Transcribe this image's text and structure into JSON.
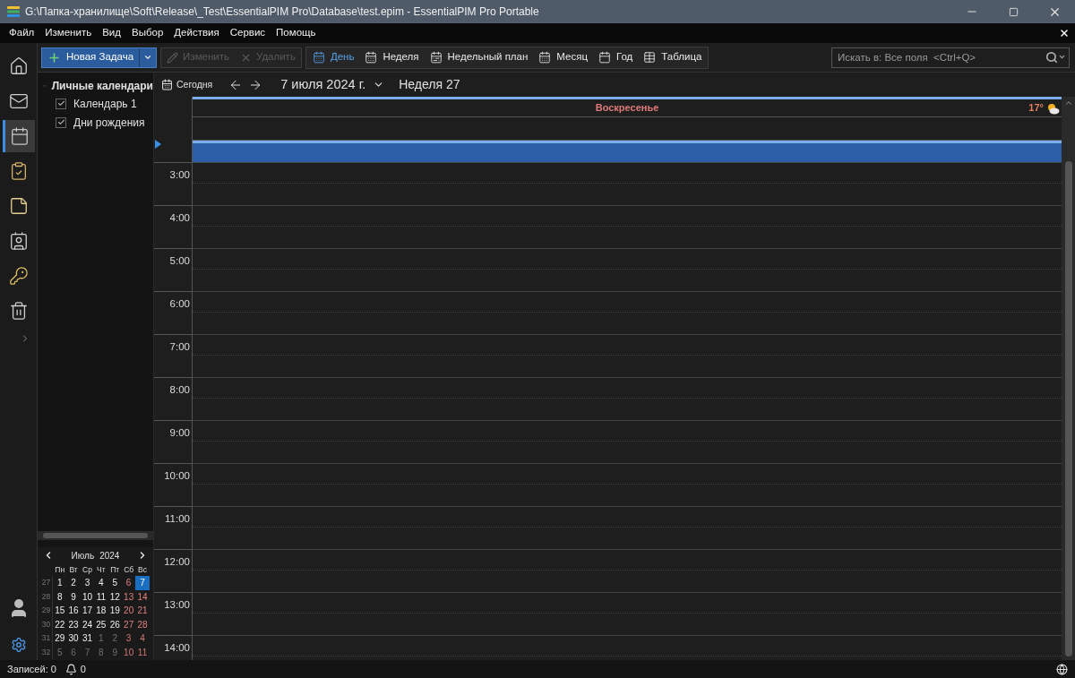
{
  "window": {
    "title": "G:\\Папка-хранилище\\Soft\\Release\\_Test\\EssentialPIM Pro\\Database\\test.epim - EssentialPIM Pro Portable"
  },
  "menu": [
    "Файл",
    "Изменить",
    "Вид",
    "Выбор",
    "Действия",
    "Сервис",
    "Помощь"
  ],
  "toolbar": {
    "new_button": "Новая Задача",
    "actions": [
      {
        "kind": "edit",
        "label": "Изменить",
        "disabled": true
      },
      {
        "kind": "delete",
        "label": "Удалить",
        "disabled": true
      }
    ],
    "views": [
      {
        "label": "День",
        "selected": true
      },
      {
        "label": "Неделя",
        "selected": false
      },
      {
        "label": "Недельный план",
        "selected": false
      },
      {
        "label": "Месяц",
        "selected": false
      },
      {
        "label": "Год",
        "selected": false
      },
      {
        "label": "Таблица",
        "selected": false
      }
    ],
    "search": {
      "placeholder": "Искать в: Все поля  <Ctrl+Q>"
    }
  },
  "nav_rail": [
    {
      "kind": "home",
      "selected": false
    },
    {
      "kind": "mail",
      "selected": false
    },
    {
      "kind": "calendar",
      "selected": true
    },
    {
      "kind": "tasks",
      "selected": false
    },
    {
      "kind": "notes",
      "selected": false
    },
    {
      "kind": "contacts",
      "selected": false
    },
    {
      "kind": "passwords",
      "selected": false
    },
    {
      "kind": "trash",
      "selected": false
    }
  ],
  "sidebar": {
    "label": "Личные календари",
    "expanded": true,
    "children": [
      {
        "label": "Календарь 1",
        "checked": true
      },
      {
        "label": "Дни рождения",
        "checked": true
      }
    ]
  },
  "mini_calendar": {
    "month": "Июль",
    "year": "2024",
    "weekdays": [
      "Пн",
      "Вт",
      "Ср",
      "Чт",
      "Пт",
      "Сб",
      "Вс"
    ],
    "weeks": [
      {
        "number": "27",
        "days": [
          {
            "day": "1",
            "other_month": false,
            "selected": false
          },
          {
            "day": "2",
            "other_month": false,
            "selected": false
          },
          {
            "day": "3",
            "other_month": false,
            "selected": false
          },
          {
            "day": "4",
            "other_month": false,
            "selected": false
          },
          {
            "day": "5",
            "other_month": false,
            "selected": false
          },
          {
            "day": "6",
            "other_month": false,
            "selected": false
          },
          {
            "day": "7",
            "other_month": false,
            "selected": true
          }
        ]
      },
      {
        "number": "28",
        "days": [
          {
            "day": "8",
            "other_month": false,
            "selected": false
          },
          {
            "day": "9",
            "other_month": false,
            "selected": false
          },
          {
            "day": "10",
            "other_month": false,
            "selected": false
          },
          {
            "day": "11",
            "other_month": false,
            "selected": false
          },
          {
            "day": "12",
            "other_month": false,
            "selected": false
          },
          {
            "day": "13",
            "other_month": false,
            "selected": false
          },
          {
            "day": "14",
            "other_month": false,
            "selected": false
          }
        ]
      },
      {
        "number": "29",
        "days": [
          {
            "day": "15",
            "other_month": false,
            "selected": false
          },
          {
            "day": "16",
            "other_month": false,
            "selected": false
          },
          {
            "day": "17",
            "other_month": false,
            "selected": false
          },
          {
            "day": "18",
            "other_month": false,
            "selected": false
          },
          {
            "day": "19",
            "other_month": false,
            "selected": false
          },
          {
            "day": "20",
            "other_month": false,
            "selected": false
          },
          {
            "day": "21",
            "other_month": false,
            "selected": false
          }
        ]
      },
      {
        "number": "30",
        "days": [
          {
            "day": "22",
            "other_month": false,
            "selected": false
          },
          {
            "day": "23",
            "other_month": false,
            "selected": false
          },
          {
            "day": "24",
            "other_month": false,
            "selected": false
          },
          {
            "day": "25",
            "other_month": false,
            "selected": false
          },
          {
            "day": "26",
            "other_month": false,
            "selected": false
          },
          {
            "day": "27",
            "other_month": false,
            "selected": false
          },
          {
            "day": "28",
            "other_month": false,
            "selected": false
          }
        ]
      },
      {
        "number": "31",
        "days": [
          {
            "day": "29",
            "other_month": false,
            "selected": false
          },
          {
            "day": "30",
            "other_month": false,
            "selected": false
          },
          {
            "day": "31",
            "other_month": false,
            "selected": false
          },
          {
            "day": "1",
            "other_month": true,
            "selected": false
          },
          {
            "day": "2",
            "other_month": true,
            "selected": false
          },
          {
            "day": "3",
            "other_month": true,
            "selected": false
          },
          {
            "day": "4",
            "other_month": true,
            "selected": false
          }
        ]
      },
      {
        "number": "32",
        "days": [
          {
            "day": "5",
            "other_month": true,
            "selected": false
          },
          {
            "day": "6",
            "other_month": true,
            "selected": false
          },
          {
            "day": "7",
            "other_month": true,
            "selected": false
          },
          {
            "day": "8",
            "other_month": true,
            "selected": false
          },
          {
            "day": "9",
            "other_month": true,
            "selected": false
          },
          {
            "day": "10",
            "other_month": true,
            "selected": false
          },
          {
            "day": "11",
            "other_month": true,
            "selected": false
          }
        ]
      }
    ]
  },
  "calendar": {
    "today_button": "Сегодня",
    "date": "7 июля 2024 г.",
    "week": "Неделя 27",
    "day_name": "Воскресенье",
    "weather": "17°",
    "hours": [
      "3:00",
      "4:00",
      "5:00",
      "6:00",
      "7:00",
      "8:00",
      "9:00",
      "10:00",
      "11:00",
      "12:00",
      "13:00",
      "14:00"
    ]
  },
  "status_bar": {
    "records": "Записей: 0",
    "reminders": "0"
  }
}
